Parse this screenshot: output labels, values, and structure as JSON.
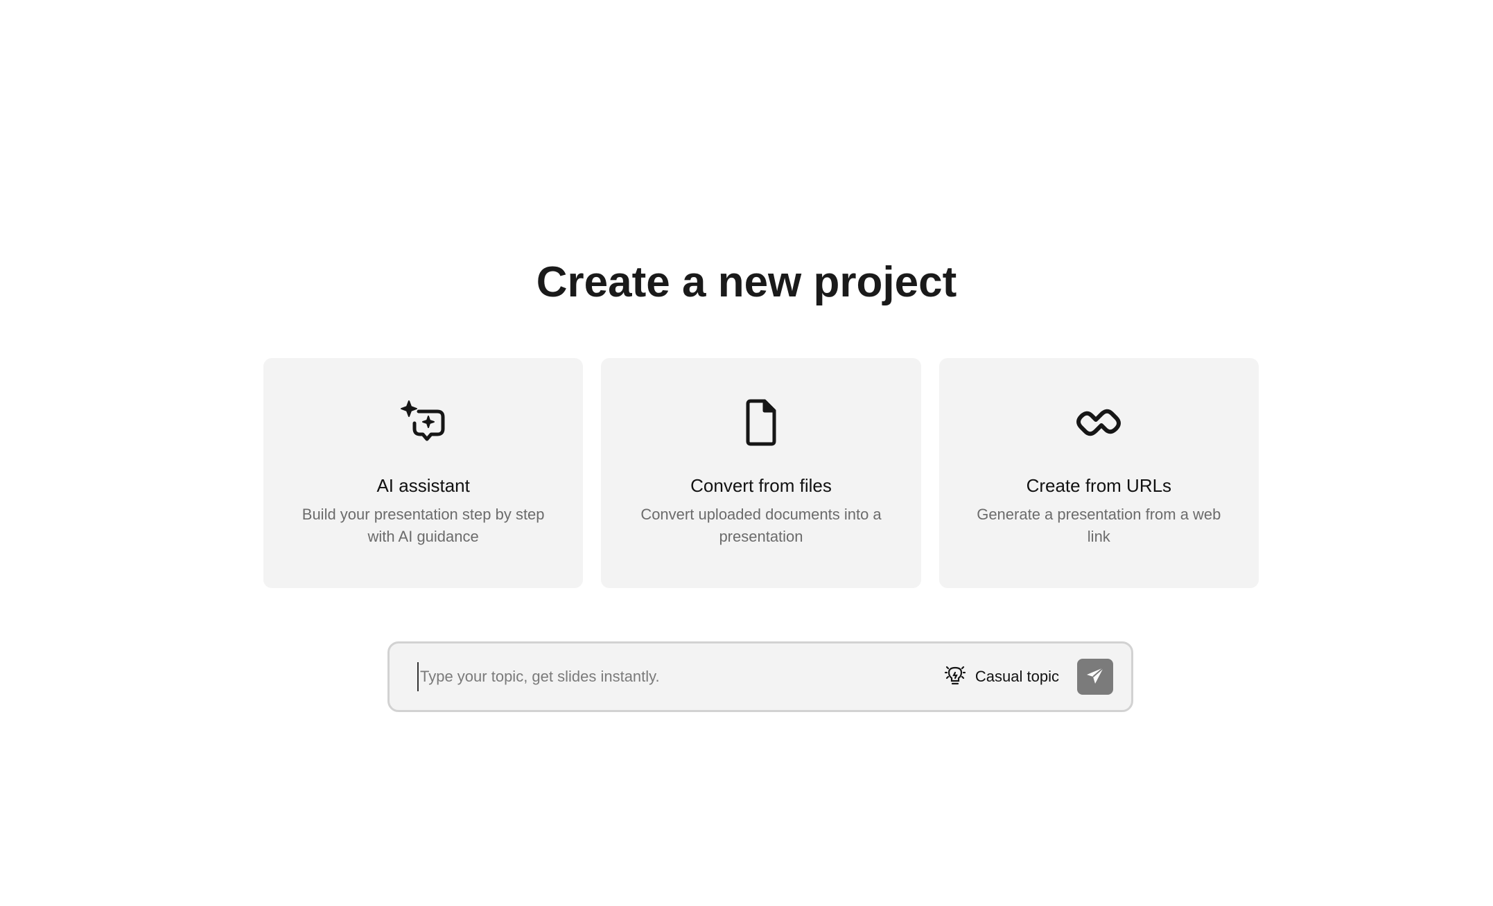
{
  "page": {
    "title": "Create a new project"
  },
  "cards": [
    {
      "icon": "ai-sparkle-chat-icon",
      "title": "AI assistant",
      "description": "Build your presentation step by step with AI guidance"
    },
    {
      "icon": "file-icon",
      "title": "Convert from files",
      "description": "Convert uploaded documents into a presentation"
    },
    {
      "icon": "link-icon",
      "title": "Create from URLs",
      "description": "Generate a presentation from a web link"
    }
  ],
  "prompt": {
    "placeholder": "Type your topic, get slides instantly.",
    "value": "",
    "topic_icon": "lightbulb-icon",
    "topic_label": "Casual topic",
    "send_icon": "send-icon"
  },
  "colors": {
    "card_background": "#f3f3f3",
    "send_button": "#7b7b7b",
    "border": "#d2d2d2"
  }
}
